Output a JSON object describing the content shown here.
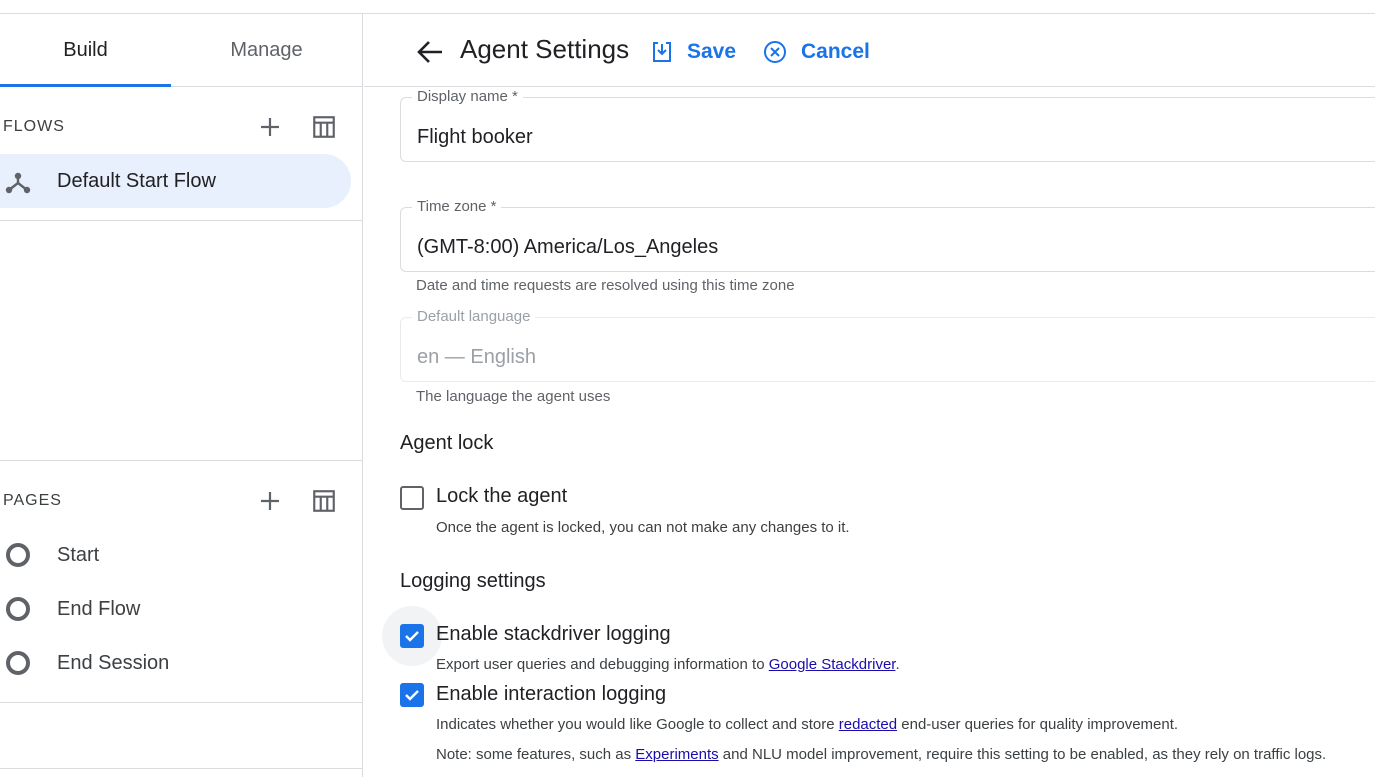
{
  "nav": {
    "tabs": [
      {
        "label": "Build",
        "selected": true
      },
      {
        "label": "Manage",
        "selected": false
      }
    ]
  },
  "flows": {
    "section_title": "FLOWS",
    "items": [
      {
        "label": "Default Start Flow",
        "icon": "flow-icon",
        "selected": true
      }
    ]
  },
  "pages": {
    "section_title": "PAGES",
    "items": [
      {
        "label": "Start",
        "icon": "page-ring-icon"
      },
      {
        "label": "End Flow",
        "icon": "page-ring-icon"
      },
      {
        "label": "End Session",
        "icon": "page-ring-icon"
      }
    ]
  },
  "header": {
    "title": "Agent Settings",
    "save_label": "Save",
    "cancel_label": "Cancel"
  },
  "form": {
    "display_name": {
      "label": "Display name *",
      "value": "Flight booker"
    },
    "time_zone": {
      "label": "Time zone *",
      "value": "(GMT-8:00) America/Los_Angeles",
      "hint": "Date and time requests are resolved using this time zone"
    },
    "default_language": {
      "label": "Default language",
      "value": "en — English",
      "hint": "The language the agent uses",
      "disabled": true
    }
  },
  "agent_lock": {
    "heading": "Agent lock",
    "checkbox_label": "Lock the agent",
    "checked": false,
    "description": "Once the agent is locked, you can not make any changes to it."
  },
  "logging": {
    "heading": "Logging settings",
    "stackdriver": {
      "label": "Enable stackdriver logging",
      "checked": true,
      "desc_prefix": "Export user queries and debugging information to ",
      "desc_link": "Google Stackdriver",
      "desc_suffix": "."
    },
    "interaction": {
      "label": "Enable interaction logging",
      "checked": true,
      "desc_prefix": "Indicates whether you would like Google to collect and store ",
      "desc_link": "redacted",
      "desc_suffix": " end-user queries for quality improvement.",
      "note_prefix": "Note: some features, such as ",
      "note_link": "Experiments",
      "note_suffix": " and NLU model improvement, require this setting to be enabled, as they rely on traffic logs."
    }
  },
  "colors": {
    "accent": "#1a73e8",
    "selected_bg": "#e8f0fe",
    "divider": "#dadce0"
  }
}
